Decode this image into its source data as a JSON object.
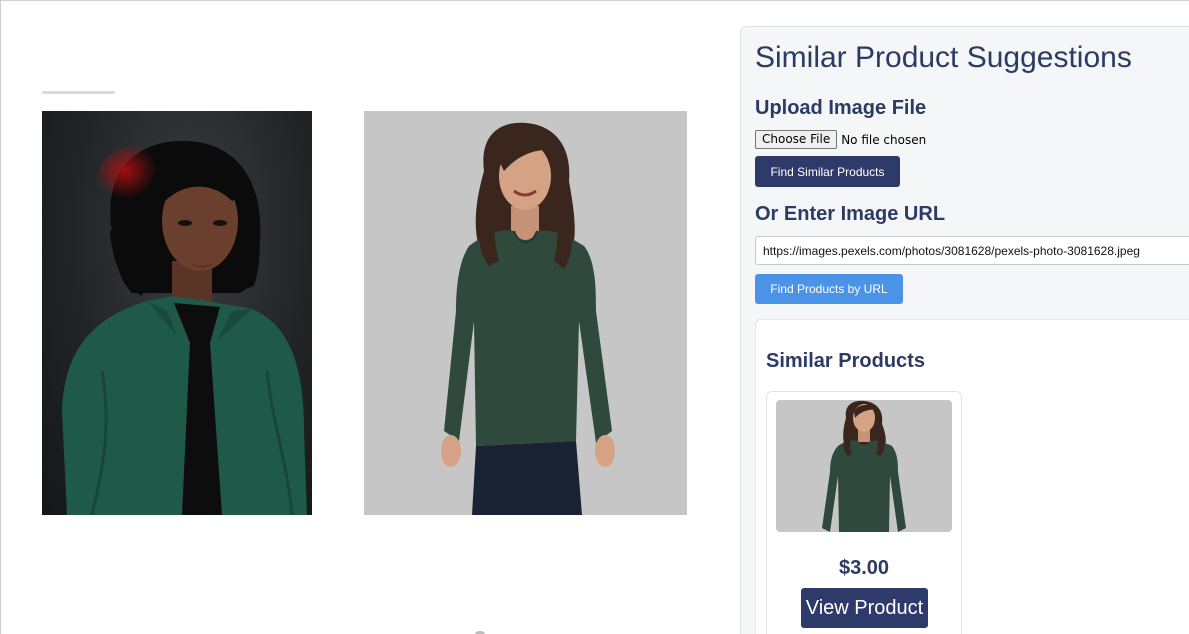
{
  "panel": {
    "title": "Similar Product Suggestions",
    "upload_heading": "Upload Image File",
    "choose_file_label": "Choose File",
    "file_status": "No file chosen",
    "find_similar_label": "Find Similar Products",
    "url_heading": "Or Enter Image URL",
    "url_value": "https://images.pexels.com/photos/3081628/pexels-photo-3081628.jpeg",
    "find_by_url_label": "Find Products by URL"
  },
  "results": {
    "title": "Similar Products",
    "products": [
      {
        "price": "$3.00",
        "view_label": "View Product"
      }
    ]
  },
  "colors": {
    "navy": "#2e3b6a",
    "heading": "#2c3b63",
    "blue": "#4a93e6",
    "shirt_green": "#2f4a3c",
    "blouse_green": "#1f5a49"
  }
}
